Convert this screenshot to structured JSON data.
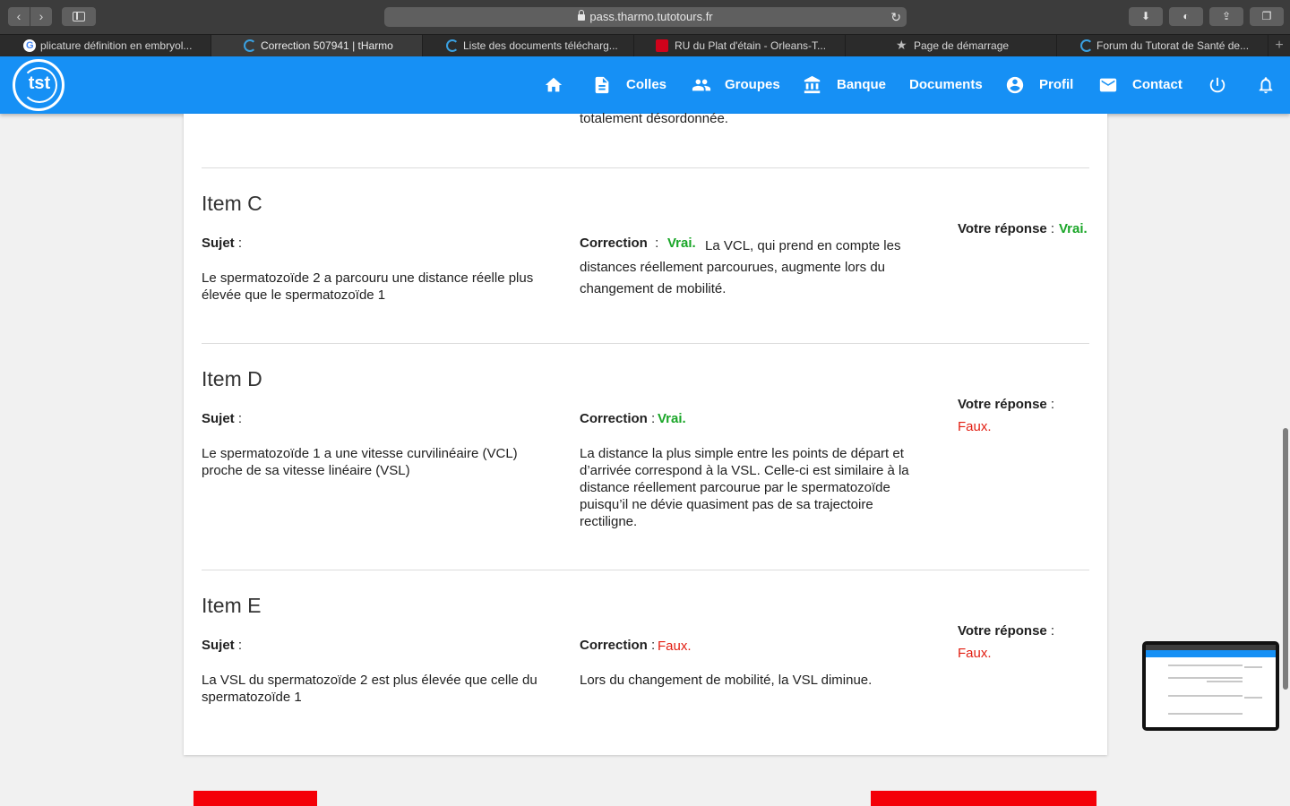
{
  "browser": {
    "url": "pass.tharmo.tutotours.fr",
    "tabs": [
      {
        "label": "plicature définition en embryol...",
        "favicon": "google-favicon"
      },
      {
        "label": "Correction 507941 | tHarmo",
        "favicon": "tutorat-favicon"
      },
      {
        "label": "Liste des documents télécharg...",
        "favicon": "tutorat-favicon"
      },
      {
        "label": "RU du Plat d'étain - Orleans-T...",
        "favicon": "ru-favicon"
      },
      {
        "label": "Page de démarrage",
        "favicon": "star-icon"
      },
      {
        "label": "Forum du Tutorat de Santé de...",
        "favicon": "tutorat-favicon"
      }
    ]
  },
  "header": {
    "logo_text": "tst",
    "nav": {
      "colles": "Colles",
      "groupes": "Groupes",
      "banque": "Banque",
      "documents": "Documents",
      "profil": "Profil",
      "contact": "Contact"
    }
  },
  "content": {
    "previous_text": "totalement désordonnée.",
    "labels": {
      "sujet": "Sujet",
      "correction": "Correction",
      "votre_reponse": "Votre réponse",
      "colon": " :"
    },
    "items": [
      {
        "title": "Item C",
        "sujet": "Le spermatozoïde 2 a parcouru une distance réelle plus élevée que le spermatozoïde 1",
        "correction_value": "Vrai.",
        "correction_text": "La VCL, qui prend en compte les distances réellement parcourues, augmente lors du changement de mobilité.",
        "reponse": "Vrai."
      },
      {
        "title": "Item D",
        "sujet": "Le spermatozoïde 1 a une vitesse curvilinéaire (VCL) proche de sa vitesse linéaire (VSL)",
        "correction_value": "Vrai.",
        "correction_text": "La distance la plus simple entre les points de départ et d’arrivée correspond à la VSL. Celle-ci est similaire à la distance réellement parcourue par le spermatozoïde puisqu’il ne dévie quasiment pas de sa trajectoire rectiligne.",
        "reponse": "Faux."
      },
      {
        "title": "Item E",
        "sujet": "La VSL du spermatozoïde 2 est plus élevée que celle du spermatozoïde 1",
        "correction_value": "Faux.",
        "correction_text": "Lors du changement de mobilité, la VSL diminue.",
        "reponse": "Faux."
      }
    ]
  },
  "colors": {
    "brand_blue": "#1690f5",
    "vrai_green": "#1aa628",
    "faux_red": "#e21e12",
    "button_red": "#f40008"
  }
}
